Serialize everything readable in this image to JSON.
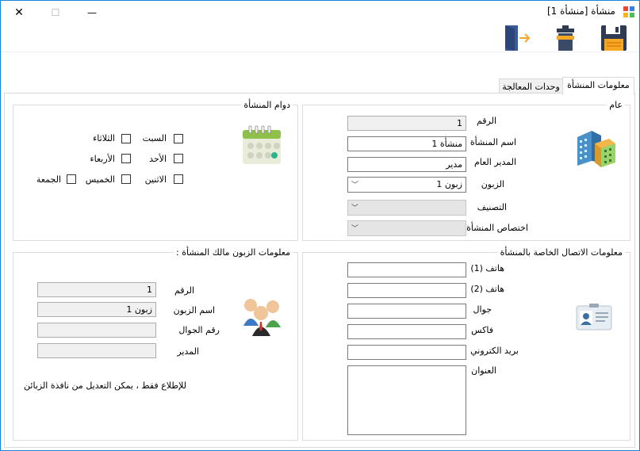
{
  "window": {
    "title": "منشأة [منشأة 1]",
    "minimize": "—",
    "maximize": "☐",
    "close": "✕"
  },
  "toolbar": {
    "save": "save-icon",
    "delete": "delete-icon",
    "exit": "exit-icon"
  },
  "tabs": [
    {
      "label": "معلومات المنشأة"
    },
    {
      "label": "وحدات المعالجة"
    }
  ],
  "general": {
    "title": "عام",
    "number_label": "الرقم",
    "number_value": "1",
    "name_label": "اسم المنشأة",
    "name_value": "منشأة 1",
    "manager_label": "المدير العام",
    "manager_value": "مدير",
    "customer_label": "الزبون",
    "customer_value": "زبون 1",
    "category_label": "التصنيف",
    "specialty_label": "اختصاص المنشأة"
  },
  "hours": {
    "title": "دوام المنشأة",
    "days": [
      "السبت",
      "الأحد",
      "الاثنين",
      "الثلاثاء",
      "الأربعاء",
      "الخميس",
      "الجمعة"
    ]
  },
  "contact": {
    "title": "معلومات الاتصال الخاصة بالمنشأة",
    "phone1_label": "هاتف (1)",
    "phone2_label": "هاتف (2)",
    "mobile_label": "جوال",
    "fax_label": "فاكس",
    "email_label": "بريد الكتروني",
    "address_label": "العنوان"
  },
  "owner": {
    "title": "معلومات الزبون مالك المنشأة :",
    "number_label": "الرقم",
    "number_value": "1",
    "name_label": "اسم الزبون",
    "name_value": "زبون 1",
    "mobile_label": "رقم الجوال",
    "manager_label": "المدير",
    "note": "للإطلاع فقط ، يمكن التعديل من نافذة الزبائن"
  }
}
